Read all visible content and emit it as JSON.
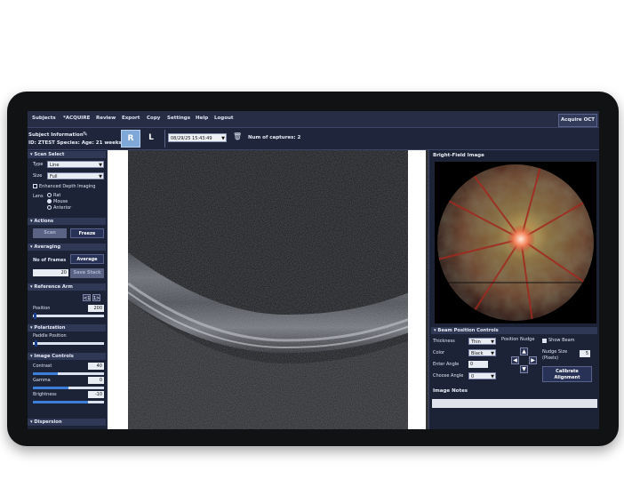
{
  "menu": {
    "items": [
      "Subjects",
      "*ACQUIRE",
      "Review",
      "Export",
      "Copy",
      "Settings",
      "Help",
      "Logout"
    ],
    "app_button": "Acquire OCT"
  },
  "subject": {
    "title": "Subject Information",
    "details": "ID: ZTEST Species:  Age: 21 weeks",
    "eye_right": "R",
    "eye_left": "L",
    "capture_date": "08/29/25 15:43:49",
    "captures_label": "Num of captures: 2"
  },
  "scan_select": {
    "header": "Scan Select",
    "type_label": "Type",
    "type_value": "Line",
    "size_label": "Size",
    "size_value": "Full",
    "edi_label": "Enhanced Depth Imaging",
    "lens_label": "Lens",
    "lens_options": [
      "Rat",
      "Mouse",
      "Anterior"
    ],
    "lens_selected": "Mouse"
  },
  "actions": {
    "header": "Actions",
    "scan_label": "Scan",
    "freeze_label": "Freeze"
  },
  "averaging": {
    "header": "Averaging",
    "frames_label": "No of Frames",
    "frames_value": "20",
    "average_label": "Average",
    "stack_label": "Save Stack"
  },
  "reference_arm": {
    "header": "Reference Arm",
    "position_label": "Position",
    "position_value": "200",
    "left_btn": "<1",
    "right_btn": "1>"
  },
  "polarization": {
    "header": "Polarization",
    "paddle_label": "Paddle Position",
    "paddle_level": 0.03
  },
  "image_controls": {
    "header": "Image Controls",
    "contrast_label": "Contrast",
    "contrast_value": "40",
    "contrast_level": 0.35,
    "gamma_label": "Gamma",
    "gamma_value": "0",
    "gamma_level": 0.5,
    "brightness_label": "Brightness",
    "brightness_value": "-10",
    "brightness_level": 0.78
  },
  "dispersion": {
    "header": "Dispersion"
  },
  "bright_field": {
    "title": "Bright-Field Image"
  },
  "beam": {
    "header": "Beam Position Controls",
    "thickness_label": "Thickness",
    "thickness_value": "Thin",
    "color_label": "Color",
    "color_value": "Black",
    "enter_angle_label": "Enter Angle",
    "enter_angle_value": "0",
    "choose_angle_label": "Choose Angle",
    "choose_angle_value": "0",
    "nudge_label": "Position Nudge",
    "show_beam_label": "Show Beam",
    "nudge_size_label": "Nudge Size (Pixels)",
    "nudge_size_value": "5",
    "calibrate_label": "Calibrate Alignment"
  },
  "notes": {
    "title": "Image Notes"
  },
  "colors": {
    "accent": "#3c7fd9",
    "panel_bg": "#1c2336",
    "menubar_bg": "#262d45"
  }
}
